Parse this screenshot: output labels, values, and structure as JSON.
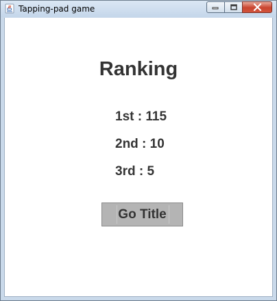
{
  "window": {
    "title": "Tapping-pad game",
    "icon": "java-cup-icon",
    "controls": [
      "minimize-icon",
      "maximize-icon",
      "close-icon"
    ]
  },
  "ranking": {
    "heading": "Ranking",
    "rows": [
      {
        "place": "1st",
        "separator": " : ",
        "score": "115"
      },
      {
        "place": "2nd",
        "separator": " : ",
        "score": "10"
      },
      {
        "place": "3rd",
        "separator": " : ",
        "score": "5"
      }
    ]
  },
  "actions": {
    "go_title_label": "Go Title"
  },
  "colors": {
    "text": "#333333",
    "button_bg": "#b4b4b4",
    "titlebar": "#c9d9ea",
    "close_button": "#c9452f"
  }
}
